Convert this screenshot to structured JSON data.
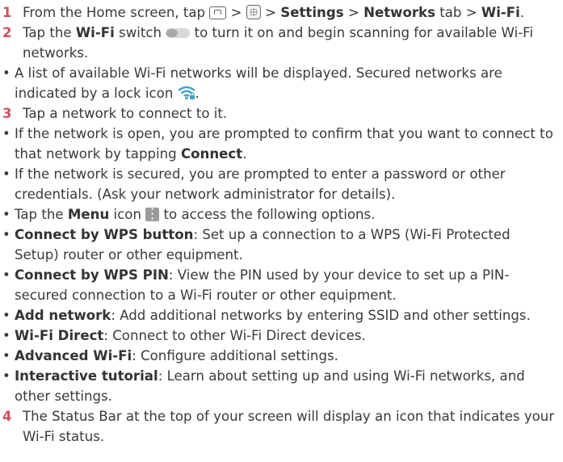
{
  "items": [
    {
      "kind": "step",
      "num": "1",
      "parts": [
        "From the Home screen, tap ",
        " > ",
        " > ",
        "Settings",
        " > ",
        "Networks",
        " tab > ",
        "Wi-Fi",
        "."
      ]
    },
    {
      "kind": "step",
      "num": "2",
      "parts": [
        "Tap the ",
        "Wi-Fi",
        " switch ",
        " to turn it on and begin scanning for available Wi-Fi networks."
      ]
    },
    {
      "kind": "bullet",
      "parts": [
        "A list of available Wi-Fi networks will be displayed. Secured networks are indicated by a lock icon ",
        "."
      ]
    },
    {
      "kind": "step",
      "num": "3",
      "parts": [
        "Tap a network to connect to it."
      ]
    },
    {
      "kind": "bullet",
      "parts": [
        "If the network is open, you are prompted to confirm that you want to connect to that network by tapping ",
        "Connect",
        "."
      ]
    },
    {
      "kind": "bullet",
      "parts": [
        "If the network is secured, you are prompted to enter a password or other credentials. (Ask your network administrator for details)."
      ]
    },
    {
      "kind": "bullet",
      "parts": [
        "Tap the ",
        "Menu",
        " icon ",
        " to access the following options."
      ]
    },
    {
      "kind": "bullet",
      "parts": [
        "Connect by WPS button",
        ": Set up a connection to a WPS (Wi-Fi Protected Setup) router or other equipment."
      ]
    },
    {
      "kind": "bullet",
      "parts": [
        "Connect by WPS PIN",
        ": View the PIN used by your device to set up a PIN-secured connection to a Wi-Fi router or other equipment."
      ]
    },
    {
      "kind": "bullet",
      "parts": [
        "Add network",
        ": Add additional networks by entering SSID and other settings."
      ]
    },
    {
      "kind": "bullet",
      "parts": [
        "Wi-Fi Direct",
        ": Connect to other Wi-Fi Direct devices."
      ]
    },
    {
      "kind": "bullet",
      "parts": [
        "Advanced Wi-Fi",
        ": Configure additional settings."
      ]
    },
    {
      "kind": "bullet",
      "parts": [
        "Interactive tutorial",
        ": Learn about setting up and using Wi-Fi networks, and other settings."
      ]
    },
    {
      "kind": "step",
      "num": "4",
      "parts": [
        "The Status Bar at the top of your screen will display an icon that  indicates your Wi-Fi status."
      ]
    }
  ],
  "bullet_char": "•",
  "icons": [
    "home-button-icon",
    "apps-icon",
    "wifi-switch-icon",
    "wifi-lock-icon",
    "menu-icon"
  ],
  "colors": {
    "step_number": "#d2515c",
    "text": "#3a3a3a"
  }
}
